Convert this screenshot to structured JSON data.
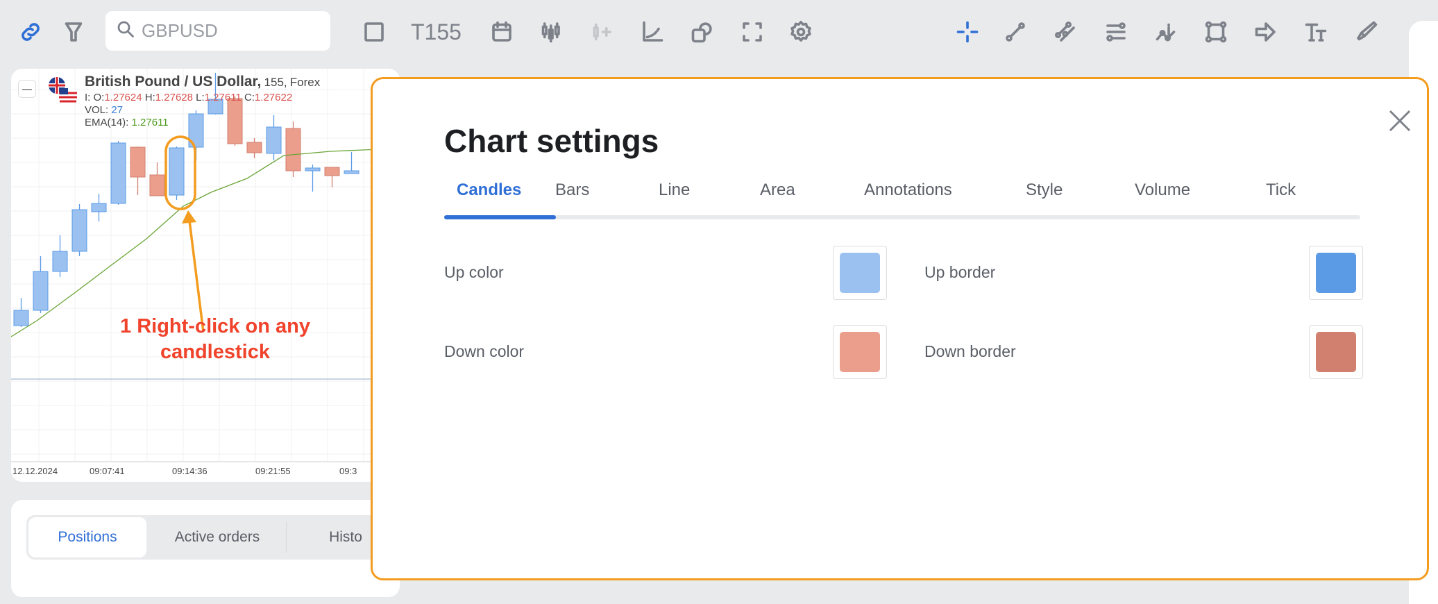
{
  "toolbar": {
    "search_placeholder": "GBPUSD",
    "timeframe": "T155",
    "left_icons": [
      "link-icon",
      "filter-icon",
      "square-icon",
      "calendar-icon",
      "candlestick-icon",
      "add-indicator-icon",
      "trend-chart-icon",
      "shapes-icon",
      "fullscreen-icon",
      "gear-icon"
    ],
    "right_icons": [
      "crosshair-icon",
      "line-tool-icon",
      "parallel-lines-icon",
      "horizontal-lines-icon",
      "info-line-icon",
      "rectangle-icon",
      "arrow-icon",
      "text-icon",
      "brush-icon"
    ],
    "accent": "#2f6fd6"
  },
  "chart": {
    "symbol": "British Pound / US Dollar,",
    "period": "155,",
    "market": "Forex",
    "ohlc": {
      "prefix": "I: O:",
      "o": "1.27624",
      "h_label": "H:",
      "h": "1.27628",
      "l_label": "L:",
      "l": "1.27611",
      "c_label": "C:",
      "c": "1.27622"
    },
    "vol_label": "VOL:",
    "vol": "27",
    "ema_label": "EMA(14):",
    "ema": "1.27611",
    "dates": [
      "12.12.2024",
      "09:07:41",
      "09:14:36",
      "09:21:55",
      "09:3"
    ],
    "up_color": "#9bc1f1",
    "down_color": "#eb9e8c"
  },
  "annotation": {
    "line1": "1 Right-click on any",
    "line2": "candlestick",
    "color": "#f0432c"
  },
  "bottom": {
    "tabs": [
      "Positions",
      "Active orders",
      "Histo"
    ]
  },
  "modal": {
    "title": "Chart settings",
    "tabs": [
      "Candles",
      "Bars",
      "Line",
      "Area",
      "Annotations",
      "Style",
      "Volume",
      "Tick"
    ],
    "active_tab": "Candles",
    "rows": [
      {
        "label": "Up color",
        "color": "#9bc1f1"
      },
      {
        "label": "Up border",
        "color": "#5b9be6"
      },
      {
        "label": "Down color",
        "color": "#eb9e8c"
      },
      {
        "label": "Down border",
        "color": "#d17f6e"
      }
    ],
    "border_color": "#f39c1f"
  }
}
